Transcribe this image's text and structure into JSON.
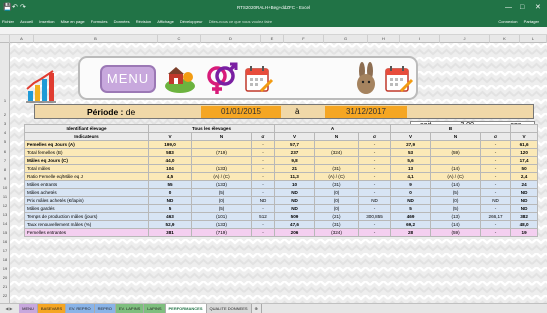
{
  "titlebar": {
    "title": "RTS2020RALH+Beg+ddZFC - Excel",
    "qa_icons": [
      "save-icon",
      "undo-icon",
      "redo-icon"
    ],
    "window_controls": [
      "—",
      "□",
      "✕"
    ]
  },
  "ribbon": {
    "tabs": [
      "Fichier",
      "Accueil",
      "Insertion",
      "Mise en page",
      "Formules",
      "Données",
      "Révision",
      "Affichage",
      "Développeur"
    ],
    "search": "Dites-nous ce que vous voulez faire",
    "right": [
      "Connexion",
      "Partager"
    ]
  },
  "columns": [
    "A",
    "B",
    "C",
    "D",
    "E",
    "F",
    "G",
    "H",
    "I",
    "J",
    "K",
    "L"
  ],
  "rows": [
    "1",
    "2",
    "3",
    "4",
    "5",
    "6",
    "7",
    "8",
    "9",
    "10",
    "11",
    "12",
    "13",
    "14",
    "15",
    "16",
    "17",
    "18",
    "19",
    "20",
    "21",
    "22"
  ],
  "banner": {
    "menu_label": "MENU"
  },
  "soit": [
    {
      "label": "soit",
      "value": "3,00",
      "unit": "ans"
    },
    {
      "label": "soit",
      "value": "1095",
      "unit": "jours"
    }
  ],
  "periode": {
    "label": "Période :",
    "de": "de",
    "start": "01/01/2015",
    "a": "à",
    "end": "31/12/2017"
  },
  "table": {
    "hdr1": [
      "Identifiant élevage",
      "Tous les élevages",
      "A",
      "B"
    ],
    "hdr2": [
      "Indicateurs",
      "V",
      "N",
      "σ",
      "V",
      "N",
      "σ",
      "V",
      "N",
      "σ",
      "V"
    ],
    "rows": [
      {
        "c": "y",
        "bold": true,
        "cells": [
          "Femelles eq Jours (A)",
          "199,0",
          "",
          "-",
          "57,7",
          "",
          "-",
          "27,9",
          "",
          "-",
          "61,6"
        ]
      },
      {
        "c": "y",
        "bold": false,
        "cells": [
          "Total femelles (B)",
          "583",
          "(719)",
          "-",
          "237",
          "(324)",
          "-",
          "53",
          "(59)",
          "-",
          "120"
        ]
      },
      {
        "c": "y",
        "bold": true,
        "cells": [
          "Mâles eq Jours (C)",
          "44,0",
          "",
          "-",
          "9,8",
          "",
          "-",
          "5,6",
          "",
          "-",
          "17,4"
        ]
      },
      {
        "c": "y",
        "bold": false,
        "cells": [
          "Total mâles",
          "104",
          "(133)",
          "-",
          "21",
          "(31)",
          "-",
          "13",
          "(14)",
          "-",
          "50"
        ]
      },
      {
        "c": "y",
        "bold": false,
        "cells": [
          "Ratio Femelle eq/Mâle eq J",
          "4,5",
          "(A) / (C)",
          "-",
          "11,3",
          "(A) / (C)",
          "-",
          "4,1",
          "(A) / (C)",
          "-",
          "2,4"
        ]
      },
      {
        "c": "b",
        "bold": false,
        "cells": [
          "Mâles entrants",
          "55",
          "(133)",
          "-",
          "10",
          "(31)",
          "-",
          "9",
          "(14)",
          "-",
          "24"
        ]
      },
      {
        "c": "b",
        "bold": false,
        "cells": [
          "Mâles achetés",
          "0",
          "(5)",
          "-",
          "ND",
          "(0)",
          "-",
          "0",
          "(5)",
          "-",
          "ND"
        ]
      },
      {
        "c": "b",
        "bold": false,
        "cells": [
          "Prix mâles achetés (€/lapin)",
          "ND",
          "(0)",
          "ND",
          "ND",
          "(0)",
          "ND",
          "ND",
          "(0)",
          "ND",
          "ND"
        ]
      },
      {
        "c": "b",
        "bold": false,
        "cells": [
          "Mâles gardés",
          "5",
          "(5)",
          "-",
          "ND",
          "(0)",
          "-",
          "5",
          "(5)",
          "-",
          "ND"
        ]
      },
      {
        "c": "b",
        "bold": false,
        "cells": [
          "Temps de production mâles (jours)",
          "463",
          "(101)",
          "512",
          "509",
          "(21)",
          "300,855",
          "469",
          "(13)",
          "266,17",
          "382"
        ]
      },
      {
        "c": "b",
        "bold": false,
        "cells": [
          "Taux renouvellement mâles (%)",
          "52,9",
          "(133)",
          "-",
          "47,6",
          "(31)",
          "-",
          "69,2",
          "(14)",
          "-",
          "48,0"
        ]
      },
      {
        "c": "p",
        "bold": false,
        "cells": [
          "Femelles entrantes",
          "381",
          "(719)",
          "-",
          "206",
          "(324)",
          "-",
          "28",
          "(59)",
          "-",
          "19"
        ]
      }
    ]
  },
  "sheet_tabs": [
    "MENU",
    "BASEVARS",
    "EV. REPRO",
    "REPRO",
    "EV. LAPINS",
    "LAPINS",
    "PERFORMANCES",
    "QUALITE DONNEES",
    "⊕"
  ],
  "active_tab": "PERFORMANCES",
  "colors": {
    "excel_green": "#217346",
    "menu_purple": "#c8a8dd",
    "date_orange": "#f5a623",
    "row_yellow": "#fbe9b7",
    "row_blue": "#d7e4f4",
    "row_pink": "#f4cff0"
  }
}
